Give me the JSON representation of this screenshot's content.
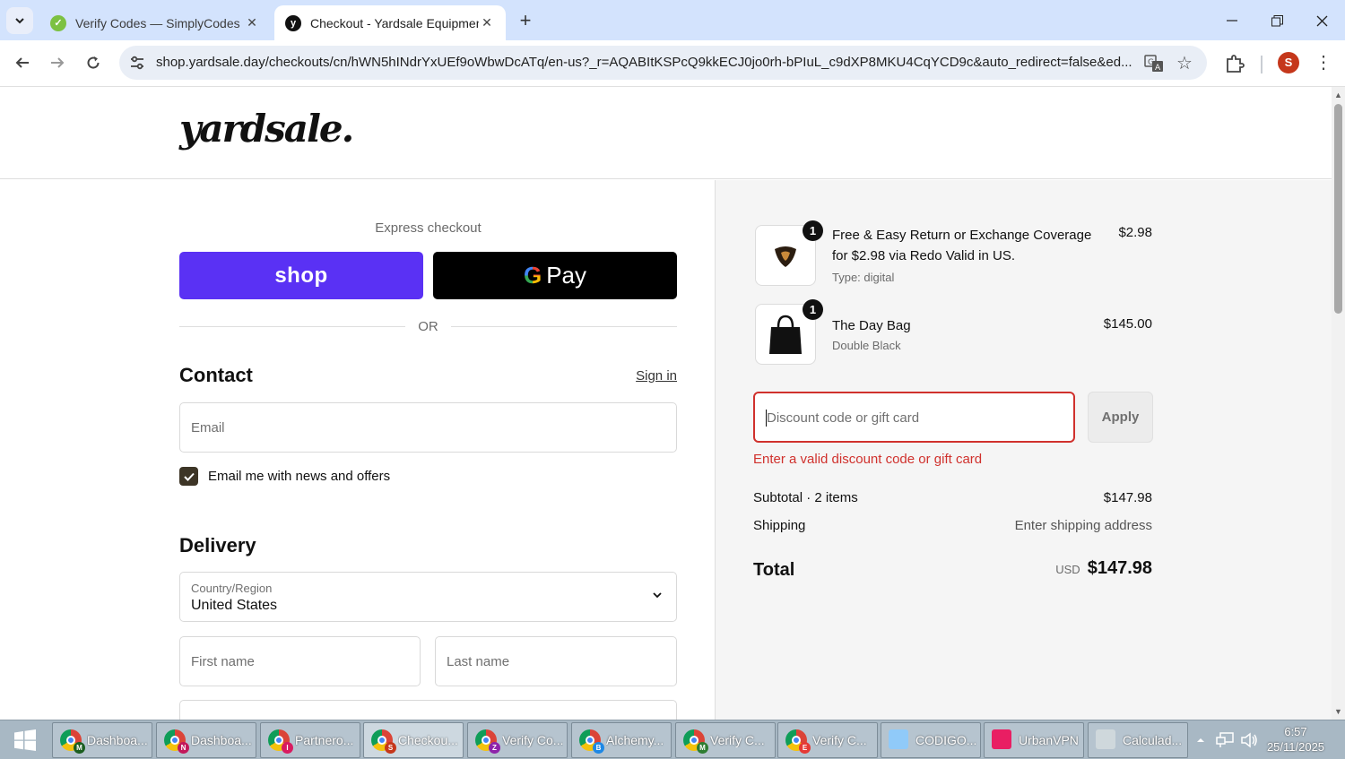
{
  "browser": {
    "tabs": [
      {
        "title": "Verify Codes — SimplyCodes",
        "active": false
      },
      {
        "title": "Checkout - Yardsale Equipment",
        "active": true
      }
    ],
    "url": "shop.yardsale.day/checkouts/cn/hWN5hINdrYxUEf9oWbwDcATq/en-us?_r=AQABItKSPcQ9kkECJ0jo0rh-bPIuL_c9dXP8MKU4CqYCD9c&auto_redirect=false&ed...",
    "profile_initial": "S"
  },
  "header": {
    "logo": "yardsale."
  },
  "express": {
    "label": "Express checkout",
    "shop_label": "shop",
    "gpay_label": "Pay",
    "or": "OR"
  },
  "contact": {
    "title": "Contact",
    "signin": "Sign in",
    "email_placeholder": "Email",
    "newsletter_label": "Email me with news and offers",
    "newsletter_checked": true
  },
  "delivery": {
    "title": "Delivery",
    "country_label": "Country/Region",
    "country_value": "United States",
    "first_name_placeholder": "First name",
    "last_name_placeholder": "Last name"
  },
  "summary": {
    "items": [
      {
        "qty": "1",
        "name_line1": "Free & Easy Return or Exchange Coverage",
        "name_line2": "for $2.98 via Redo Valid in US.",
        "sub": "Type: digital",
        "price": "$2.98"
      },
      {
        "qty": "1",
        "name_line1": "The Day Bag",
        "sub": "Double Black",
        "price": "$145.00"
      }
    ],
    "discount_placeholder": "Discount code or gift card",
    "apply_label": "Apply",
    "error": "Enter a valid discount code or gift card",
    "subtotal_label": "Subtotal · 2 items",
    "subtotal_value": "$147.98",
    "shipping_label": "Shipping",
    "shipping_value": "Enter shipping address",
    "total_label": "Total",
    "total_currency": "USD",
    "total_value": "$147.98"
  },
  "taskbar": {
    "items": [
      {
        "label": "Dashboa...",
        "badge": "M",
        "badge_color": "#1b5e20",
        "kind": "chrome"
      },
      {
        "label": "Dashboa...",
        "badge": "N",
        "badge_color": "#c2185b",
        "kind": "chrome"
      },
      {
        "label": "Partnero...",
        "badge": "I",
        "badge_color": "#d81b60",
        "kind": "chrome"
      },
      {
        "label": "Checkou...",
        "badge": "S",
        "badge_color": "#c5371b",
        "kind": "chrome"
      },
      {
        "label": "Verify Co...",
        "badge": "Z",
        "badge_color": "#8e24aa",
        "kind": "chrome"
      },
      {
        "label": "Alchemy...",
        "badge": "B",
        "badge_color": "#1e88e5",
        "kind": "chrome"
      },
      {
        "label": "Verify C...",
        "badge": "M",
        "badge_color": "#2e7d32",
        "kind": "chrome"
      },
      {
        "label": "Verify C...",
        "badge": "E",
        "badge_color": "#e53935",
        "kind": "chrome"
      },
      {
        "label": "CODIGO...",
        "badge": "",
        "badge_color": "#90caf9",
        "kind": "notepad"
      },
      {
        "label": "UrbanVPN",
        "badge": "",
        "badge_color": "#e91e63",
        "kind": "vpn"
      },
      {
        "label": "Calculad...",
        "badge": "",
        "badge_color": "#cfd8dc",
        "kind": "calc"
      }
    ],
    "time": "6:57",
    "date": "25/11/2025"
  },
  "colors": {
    "shop_purple": "#5a31f4",
    "error_red": "#d0312d",
    "checkbox": "#3d3526",
    "tabbar": "#d3e3fd"
  }
}
